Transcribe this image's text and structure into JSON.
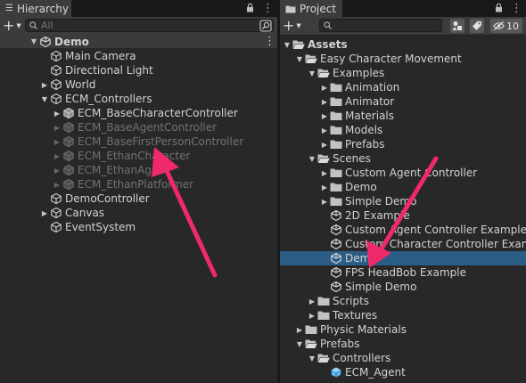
{
  "hierarchy": {
    "tab_label": "Hierarchy",
    "search_placeholder": "All",
    "items": [
      {
        "label": "Demo",
        "kind": "scene",
        "state": "expanded"
      },
      {
        "label": "Main Camera",
        "kind": "gameobject"
      },
      {
        "label": "Directional Light",
        "kind": "gameobject"
      },
      {
        "label": "World",
        "kind": "gameobject",
        "state": "collapsed"
      },
      {
        "label": "ECM_Controllers",
        "kind": "gameobject",
        "state": "expanded"
      },
      {
        "label": "ECM_BaseCharacterController",
        "kind": "prefab-instance",
        "state": "collapsed"
      },
      {
        "label": "ECM_BaseAgentController",
        "kind": "prefab-instance",
        "state": "collapsed",
        "inactive": true
      },
      {
        "label": "ECM_BaseFirstPersonController",
        "kind": "prefab-instance",
        "state": "collapsed",
        "inactive": true
      },
      {
        "label": "ECM_EthanCharacter",
        "kind": "prefab-instance",
        "state": "collapsed",
        "inactive": true
      },
      {
        "label": "ECM_EthanAgent",
        "kind": "prefab-instance",
        "state": "collapsed",
        "inactive": true
      },
      {
        "label": "ECM_EthanPlatformer",
        "kind": "prefab-instance",
        "state": "collapsed",
        "inactive": true
      },
      {
        "label": "DemoController",
        "kind": "gameobject"
      },
      {
        "label": "Canvas",
        "kind": "gameobject",
        "state": "collapsed"
      },
      {
        "label": "EventSystem",
        "kind": "gameobject"
      }
    ]
  },
  "project": {
    "tab_label": "Project",
    "search_placeholder": "",
    "hidden_count": "10",
    "items": [
      {
        "label": "Assets",
        "kind": "folder-open",
        "state": "expanded"
      },
      {
        "label": "Easy Character Movement",
        "kind": "folder-open",
        "state": "expanded"
      },
      {
        "label": "Examples",
        "kind": "folder-open",
        "state": "expanded"
      },
      {
        "label": "Animation",
        "kind": "folder",
        "state": "collapsed"
      },
      {
        "label": "Animator",
        "kind": "folder",
        "state": "collapsed"
      },
      {
        "label": "Materials",
        "kind": "folder",
        "state": "collapsed"
      },
      {
        "label": "Models",
        "kind": "folder",
        "state": "collapsed"
      },
      {
        "label": "Prefabs",
        "kind": "folder",
        "state": "collapsed"
      },
      {
        "label": "Scenes",
        "kind": "folder-open",
        "state": "expanded"
      },
      {
        "label": "Custom Agent Controller",
        "kind": "folder",
        "state": "collapsed"
      },
      {
        "label": "Demo",
        "kind": "folder",
        "state": "collapsed"
      },
      {
        "label": "Simple Demo",
        "kind": "folder",
        "state": "collapsed"
      },
      {
        "label": "2D Example",
        "kind": "scene"
      },
      {
        "label": "Custom Agent Controller Example",
        "kind": "scene"
      },
      {
        "label": "Custom Character Controller Example",
        "kind": "scene"
      },
      {
        "label": "Demo",
        "kind": "scene",
        "selected": true
      },
      {
        "label": "FPS HeadBob Example",
        "kind": "scene"
      },
      {
        "label": "Simple Demo",
        "kind": "scene"
      },
      {
        "label": "Scripts",
        "kind": "folder",
        "state": "collapsed"
      },
      {
        "label": "Textures",
        "kind": "folder",
        "state": "collapsed"
      },
      {
        "label": "Physic Materials",
        "kind": "folder",
        "state": "collapsed"
      },
      {
        "label": "Prefabs",
        "kind": "folder-open",
        "state": "expanded"
      },
      {
        "label": "Controllers",
        "kind": "folder-open",
        "state": "expanded"
      },
      {
        "label": "ECM_Agent",
        "kind": "prefab"
      }
    ]
  },
  "colors": {
    "selection": "#2c5d87",
    "annotation_arrow": "#f0296a",
    "panel_bg": "#282828",
    "toolbar_bg": "#3c3c3c"
  }
}
